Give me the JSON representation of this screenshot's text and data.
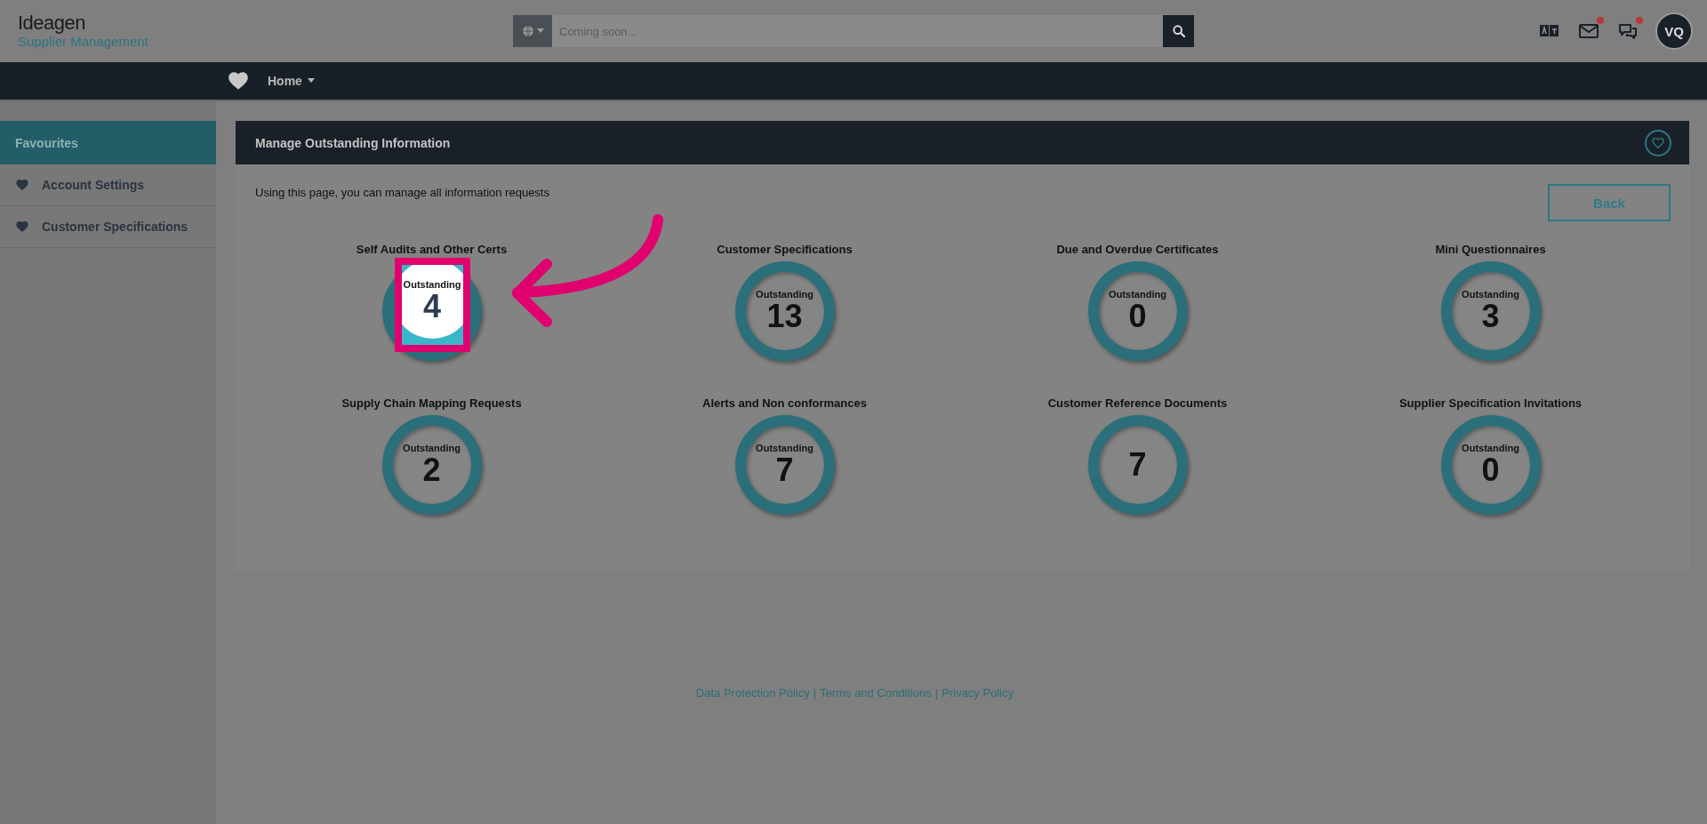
{
  "header": {
    "logo": {
      "brand": "Ideagen",
      "product": "Supplier Management"
    },
    "search": {
      "placeholder": "Coming soon..."
    },
    "notifications": [
      {
        "kind": "translate",
        "unread": false
      },
      {
        "kind": "mail",
        "unread": true
      },
      {
        "kind": "chat",
        "unread": true
      }
    ],
    "avatar": "VQ"
  },
  "nav": {
    "items": [
      {
        "label": "Home"
      }
    ]
  },
  "sidebar": {
    "title": "Favourites",
    "items": [
      {
        "label": "Account Settings"
      },
      {
        "label": "Customer Specifications"
      }
    ]
  },
  "panel": {
    "title": "Manage Outstanding Information",
    "intro": "Using this page, you can manage all information requests",
    "back_button": "Back",
    "tiles": [
      {
        "title": "Self Audits and Other Certs",
        "label": "Outstanding",
        "count": "4",
        "highlighted": true
      },
      {
        "title": "Customer Specifications",
        "label": "Outstanding",
        "count": "13",
        "highlighted": false
      },
      {
        "title": "Due and Overdue Certificates",
        "label": "Outstanding",
        "count": "0",
        "highlighted": false
      },
      {
        "title": "Mini Questionnaires",
        "label": "Outstanding",
        "count": "3",
        "highlighted": false
      },
      {
        "title": "Supply Chain Mapping Requests",
        "label": "Outstanding",
        "count": "2",
        "highlighted": false
      },
      {
        "title": "Alerts and Non conformances",
        "label": "Outstanding",
        "count": "7",
        "highlighted": false
      },
      {
        "title": "Customer Reference Documents",
        "count": "7",
        "highlighted": false
      },
      {
        "title": "Supplier Specification Invitations",
        "label": "Outstanding",
        "count": "0",
        "highlighted": false
      }
    ]
  },
  "footer": {
    "links": [
      "Data Protection Policy",
      "Terms and Conditions",
      "Privacy Policy"
    ],
    "separator": "|"
  }
}
